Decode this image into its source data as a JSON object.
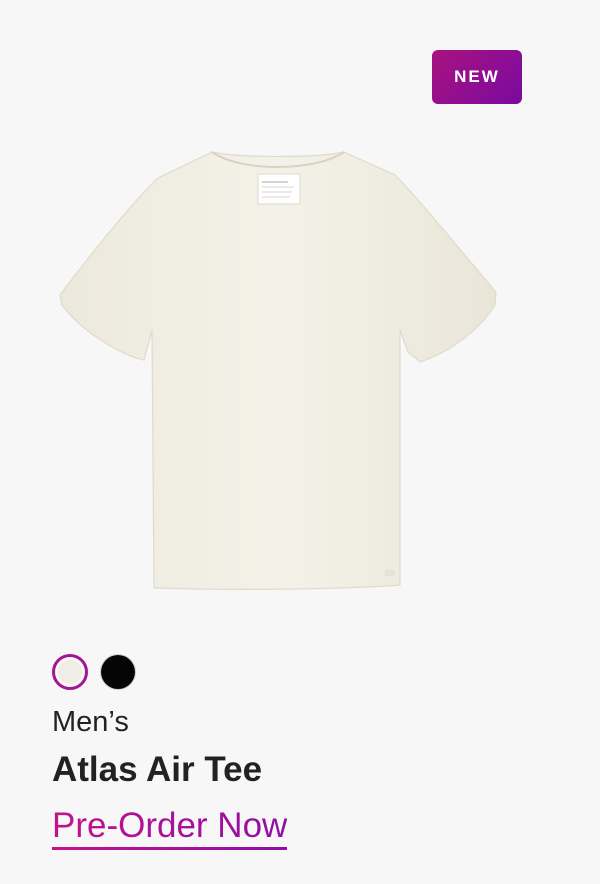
{
  "badge": {
    "label": "NEW"
  },
  "product": {
    "image_alt": "Atlas Air Tee",
    "category": "Men’s",
    "name": "Atlas Air Tee",
    "cta_label": "Pre-Order Now"
  },
  "swatches": [
    {
      "color": "#efede4",
      "selected": true
    },
    {
      "color": "#050505",
      "selected": false
    }
  ],
  "colors": {
    "accent": "#a3168f",
    "badge_start": "#a8127f",
    "badge_end": "#7a0aa0",
    "text": "#222222",
    "background": "#f7f7f7"
  }
}
